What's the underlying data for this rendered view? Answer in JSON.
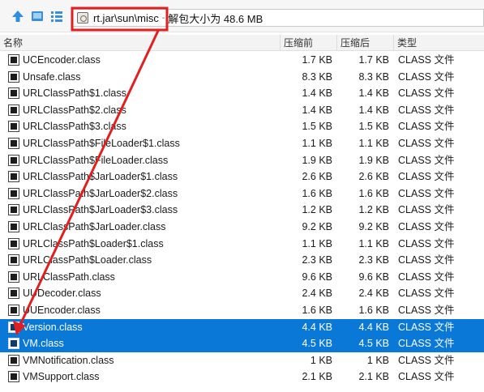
{
  "toolbar": {
    "up_icon": "arrow-up-icon",
    "view_icon": "panel-icon",
    "list_icon": "list-icon"
  },
  "path": {
    "location": "rt.jar\\sun\\misc",
    "separator": "-",
    "info": "解包大小为 48.6 MB"
  },
  "columns": {
    "name": "名称",
    "packed": "压缩前",
    "unpacked": "压缩后",
    "type": "类型"
  },
  "files": [
    {
      "name": "UCEncoder.class",
      "packed": "1.7 KB",
      "unpacked": "1.7 KB",
      "type": "CLASS 文件",
      "selected": false
    },
    {
      "name": "Unsafe.class",
      "packed": "8.3 KB",
      "unpacked": "8.3 KB",
      "type": "CLASS 文件",
      "selected": false
    },
    {
      "name": "URLClassPath$1.class",
      "packed": "1.4 KB",
      "unpacked": "1.4 KB",
      "type": "CLASS 文件",
      "selected": false
    },
    {
      "name": "URLClassPath$2.class",
      "packed": "1.4 KB",
      "unpacked": "1.4 KB",
      "type": "CLASS 文件",
      "selected": false
    },
    {
      "name": "URLClassPath$3.class",
      "packed": "1.5 KB",
      "unpacked": "1.5 KB",
      "type": "CLASS 文件",
      "selected": false
    },
    {
      "name": "URLClassPath$FileLoader$1.class",
      "packed": "1.1 KB",
      "unpacked": "1.1 KB",
      "type": "CLASS 文件",
      "selected": false
    },
    {
      "name": "URLClassPath$FileLoader.class",
      "packed": "1.9 KB",
      "unpacked": "1.9 KB",
      "type": "CLASS 文件",
      "selected": false
    },
    {
      "name": "URLClassPath$JarLoader$1.class",
      "packed": "2.6 KB",
      "unpacked": "2.6 KB",
      "type": "CLASS 文件",
      "selected": false
    },
    {
      "name": "URLClassPath$JarLoader$2.class",
      "packed": "1.6 KB",
      "unpacked": "1.6 KB",
      "type": "CLASS 文件",
      "selected": false
    },
    {
      "name": "URLClassPath$JarLoader$3.class",
      "packed": "1.2 KB",
      "unpacked": "1.2 KB",
      "type": "CLASS 文件",
      "selected": false
    },
    {
      "name": "URLClassPath$JarLoader.class",
      "packed": "9.2 KB",
      "unpacked": "9.2 KB",
      "type": "CLASS 文件",
      "selected": false
    },
    {
      "name": "URLClassPath$Loader$1.class",
      "packed": "1.1 KB",
      "unpacked": "1.1 KB",
      "type": "CLASS 文件",
      "selected": false
    },
    {
      "name": "URLClassPath$Loader.class",
      "packed": "2.3 KB",
      "unpacked": "2.3 KB",
      "type": "CLASS 文件",
      "selected": false
    },
    {
      "name": "URLClassPath.class",
      "packed": "9.6 KB",
      "unpacked": "9.6 KB",
      "type": "CLASS 文件",
      "selected": false
    },
    {
      "name": "UUDecoder.class",
      "packed": "2.4 KB",
      "unpacked": "2.4 KB",
      "type": "CLASS 文件",
      "selected": false
    },
    {
      "name": "UUEncoder.class",
      "packed": "1.6 KB",
      "unpacked": "1.6 KB",
      "type": "CLASS 文件",
      "selected": false
    },
    {
      "name": "Version.class",
      "packed": "4.4 KB",
      "unpacked": "4.4 KB",
      "type": "CLASS 文件",
      "selected": true
    },
    {
      "name": "VM.class",
      "packed": "4.5 KB",
      "unpacked": "4.5 KB",
      "type": "CLASS 文件",
      "selected": true
    },
    {
      "name": "VMNotification.class",
      "packed": "1 KB",
      "unpacked": "1 KB",
      "type": "CLASS 文件",
      "selected": false
    },
    {
      "name": "VMSupport.class",
      "packed": "2.1 KB",
      "unpacked": "2.1 KB",
      "type": "CLASS 文件",
      "selected": false
    }
  ],
  "colors": {
    "selection": "#0a78d7",
    "annotation": "#e02020"
  }
}
